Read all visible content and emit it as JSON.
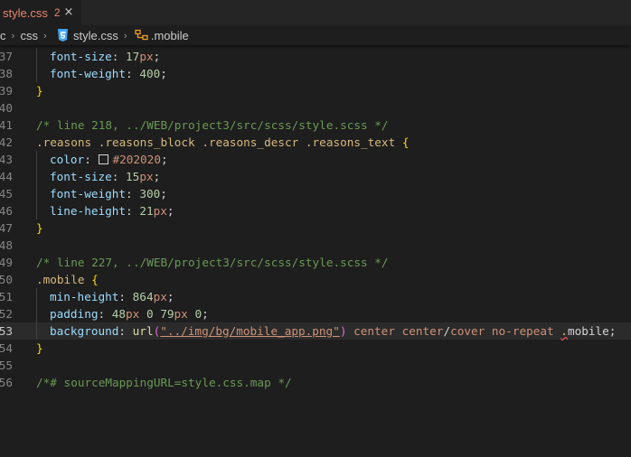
{
  "tab": {
    "filename": "style.css",
    "problem_count": "2",
    "close_glyph": "×"
  },
  "breadcrumb": {
    "part1": "c",
    "part2": "css",
    "part3": "style.css",
    "part4": ".mobile"
  },
  "editor": {
    "lines": [
      {
        "num": "37",
        "segs": [
          [
            "p",
            "font-size"
          ],
          [
            "d",
            ": "
          ],
          [
            "n",
            "17"
          ],
          [
            "u",
            "px"
          ],
          [
            "d",
            ";"
          ]
        ]
      },
      {
        "num": "38",
        "segs": [
          [
            "p",
            "font-weight"
          ],
          [
            "d",
            ": "
          ],
          [
            "n",
            "400"
          ],
          [
            "d",
            ";"
          ]
        ]
      },
      {
        "num": "39",
        "segs": [
          [
            "b1",
            "}"
          ]
        ]
      },
      {
        "num": "40",
        "segs": []
      },
      {
        "num": "41",
        "segs": [
          [
            "c",
            "/* line 218, ../WEB/project3/src/scss/style.scss */"
          ]
        ]
      },
      {
        "num": "42",
        "segs": [
          [
            "k",
            ".reasons .reasons_block .reasons_descr .reasons_text"
          ],
          [
            "d",
            " "
          ],
          [
            "b1",
            "{"
          ]
        ]
      },
      {
        "num": "43",
        "segs": [
          [
            "p",
            "color"
          ],
          [
            "d",
            ": "
          ],
          [
            "swatch",
            "#202020"
          ],
          [
            "s",
            "#202020"
          ],
          [
            "d",
            ";"
          ]
        ]
      },
      {
        "num": "44",
        "segs": [
          [
            "p",
            "font-size"
          ],
          [
            "d",
            ": "
          ],
          [
            "n",
            "15"
          ],
          [
            "u",
            "px"
          ],
          [
            "d",
            ";"
          ]
        ]
      },
      {
        "num": "45",
        "segs": [
          [
            "p",
            "font-weight"
          ],
          [
            "d",
            ": "
          ],
          [
            "n",
            "300"
          ],
          [
            "d",
            ";"
          ]
        ]
      },
      {
        "num": "46",
        "segs": [
          [
            "p",
            "line-height"
          ],
          [
            "d",
            ": "
          ],
          [
            "n",
            "21"
          ],
          [
            "u",
            "px"
          ],
          [
            "d",
            ";"
          ]
        ]
      },
      {
        "num": "47",
        "segs": [
          [
            "b1",
            "}"
          ]
        ]
      },
      {
        "num": "48",
        "segs": []
      },
      {
        "num": "49",
        "segs": [
          [
            "c",
            "/* line 227, ../WEB/project3/src/scss/style.scss */"
          ]
        ]
      },
      {
        "num": "50",
        "segs": [
          [
            "k",
            ".mobile"
          ],
          [
            "d",
            " "
          ],
          [
            "b1",
            "{"
          ]
        ]
      },
      {
        "num": "51",
        "segs": [
          [
            "p",
            "min-height"
          ],
          [
            "d",
            ": "
          ],
          [
            "n",
            "864"
          ],
          [
            "u",
            "px"
          ],
          [
            "d",
            ";"
          ]
        ]
      },
      {
        "num": "52",
        "segs": [
          [
            "p",
            "padding"
          ],
          [
            "d",
            ": "
          ],
          [
            "n",
            "48"
          ],
          [
            "u",
            "px"
          ],
          [
            "d",
            " "
          ],
          [
            "n",
            "0"
          ],
          [
            "d",
            " "
          ],
          [
            "n",
            "79"
          ],
          [
            "u",
            "px"
          ],
          [
            "d",
            " "
          ],
          [
            "n",
            "0"
          ],
          [
            "d",
            ";"
          ]
        ]
      },
      {
        "num": "53",
        "active": true,
        "segs": [
          [
            "p",
            "background"
          ],
          [
            "d",
            ": "
          ],
          [
            "f",
            "url"
          ],
          [
            "b2",
            "("
          ],
          [
            "sl",
            "\"../img/bg/mobile_app.png\""
          ],
          [
            "b2",
            ")"
          ],
          [
            "d",
            " "
          ],
          [
            "s",
            "center center"
          ],
          [
            "d",
            "/"
          ],
          [
            "s",
            "cover no-repeat"
          ],
          [
            "d",
            " "
          ],
          [
            "sq",
            "."
          ],
          [
            "d",
            "mobile;"
          ]
        ]
      },
      {
        "num": "54",
        "segs": [
          [
            "b1",
            "}"
          ]
        ]
      },
      {
        "num": "55",
        "segs": []
      },
      {
        "num": "56",
        "segs": [
          [
            "c",
            "/*# sourceMappingURL=style.css.map */"
          ]
        ]
      }
    ]
  }
}
